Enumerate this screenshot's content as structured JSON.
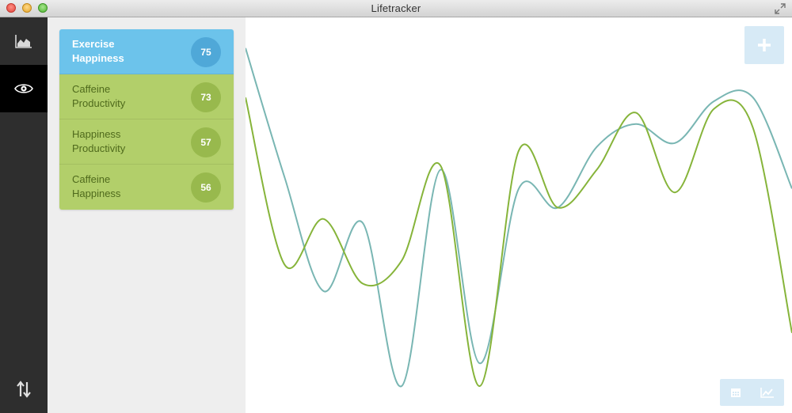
{
  "window": {
    "title": "Lifetracker"
  },
  "nav": {
    "items": [
      {
        "icon": "area-chart-icon",
        "active": false
      },
      {
        "icon": "eye-icon",
        "active": true
      },
      {
        "icon": "sort-arrows-icon",
        "active": false
      }
    ]
  },
  "correlations": [
    {
      "first": "Exercise",
      "second": "Happiness",
      "score": "75",
      "selected": true
    },
    {
      "first": "Caffeine",
      "second": "Productivity",
      "score": "73",
      "selected": false
    },
    {
      "first": "Happiness",
      "second": "Productivity",
      "score": "57",
      "selected": false
    },
    {
      "first": "Caffeine",
      "second": "Happiness",
      "score": "56",
      "selected": false
    }
  ],
  "toolbar": {
    "add_icon": "plus-icon",
    "tools": [
      "calendar-icon",
      "line-chart-icon"
    ]
  },
  "colors": {
    "accent_blue": "#6cc3eb",
    "accent_green": "#b2cf6a",
    "series_teal": "#79b6b3",
    "series_green": "#86b43a"
  },
  "chart_data": {
    "type": "line",
    "title": "",
    "xlabel": "",
    "ylabel": "",
    "x": [
      0,
      1,
      2,
      3,
      4,
      5,
      6,
      7,
      8,
      9,
      10,
      11,
      12,
      13,
      14
    ],
    "ylim": [
      0,
      100
    ],
    "series": [
      {
        "color": "#79b6b3",
        "values": [
          94,
          60,
          30,
          48,
          5,
          62,
          11,
          57,
          52,
          68,
          74,
          69,
          80,
          81,
          57
        ]
      },
      {
        "color": "#86b43a",
        "values": [
          81,
          37,
          49,
          32,
          38,
          63,
          5,
          67,
          52,
          62,
          77,
          56,
          78,
          73,
          19
        ]
      }
    ]
  }
}
